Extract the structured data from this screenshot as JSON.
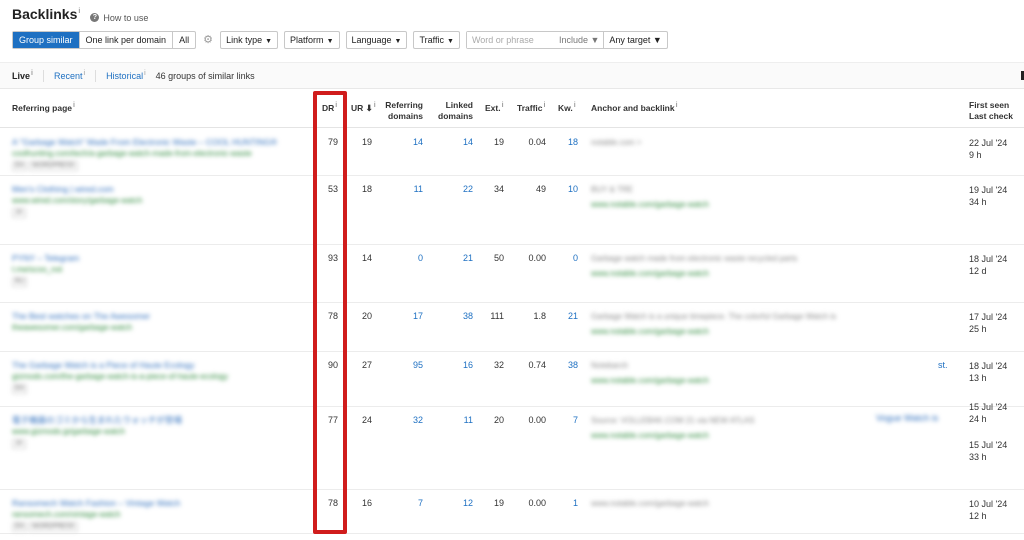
{
  "header": {
    "title": "Backlinks",
    "title_info": "i",
    "howto": "How to use",
    "howto_icon": "question-icon"
  },
  "toolbar": {
    "group_similar": "Group similar",
    "one_link": "One link per domain",
    "all": "All",
    "link_type": "Link type",
    "platform": "Platform",
    "language": "Language",
    "traffic": "Traffic",
    "search_placeholder": "Word or phrase",
    "include": "Include",
    "any_target": "Any target",
    "accent": "#1e70c2"
  },
  "subbar": {
    "live": "Live",
    "recent": "Recent",
    "historical": "Historical",
    "groups_count": "46 groups of similar links"
  },
  "columns": {
    "referring_page": "Referring page",
    "dr": "DR",
    "ur": "UR",
    "referring_domains_1": "Referring",
    "referring_domains_2": "domains",
    "linked_domains_1": "Linked",
    "linked_domains_2": "domains",
    "ext": "Ext.",
    "traffic": "Traffic",
    "kw": "Kw.",
    "anchor": "Anchor and backlink",
    "first_seen": "First seen",
    "last_check": "Last check"
  },
  "rows": [
    {
      "dr": "79",
      "ur": "19",
      "ref_domains": "14",
      "linked": "14",
      "ext": "19",
      "traffic": "0.04",
      "kw": "18",
      "dates": [
        "22 Jul '24",
        "9 h"
      ],
      "page_title": "A \"Garbage Watch\" Made From Electronic Waste – COOL HUNTING®",
      "page_url": "coolhunting.com/tech/a-garbage-watch-made-from-electronic-waste",
      "tags": [
        "EN",
        "WORDPRESS"
      ],
      "anchor_lines": [
        "notable.com  >"
      ]
    },
    {
      "dr": "53",
      "ur": "18",
      "ref_domains": "11",
      "linked": "22",
      "ext": "34",
      "traffic": "49",
      "kw": "10",
      "dates": [
        "19 Jul '24",
        "34 h"
      ],
      "page_title": "Men's Clothing | wired.com",
      "page_url": "www.wired.com/story/garbage-watch",
      "tags": [
        "JA"
      ],
      "anchor_lines": [
        "BUY & TRE",
        "www.notable.com/garbage-watch"
      ]
    },
    {
      "dr": "93",
      "ur": "14",
      "ref_domains": "0",
      "linked": "21",
      "ext": "50",
      "traffic": "0.00",
      "kw": "0",
      "dates": [
        "18 Jul '24",
        "12 d"
      ],
      "page_title": "PYNY – Telegram",
      "page_url": "t.me/scoo_not",
      "tags": [
        "RU"
      ],
      "anchor_lines": [
        "Garbage watch made from electronic waste recycled parts",
        "www.notable.com/garbage-watch"
      ]
    },
    {
      "dr": "78",
      "ur": "20",
      "ref_domains": "17",
      "linked": "38",
      "ext": "111",
      "traffic": "1.8",
      "kw": "21",
      "dates": [
        "17 Jul '24",
        "25 h"
      ],
      "page_title": "The Best watches on The Awesomer",
      "page_url": "theawesomer.com/garbage-watch",
      "tags": [],
      "anchor_lines": [
        "Garbage Watch is a unique timepiece. The colorful Garbage Watch is",
        "www.notable.com/garbage-watch"
      ]
    },
    {
      "dr": "90",
      "ur": "27",
      "ref_domains": "95",
      "linked": "16",
      "ext": "32",
      "traffic": "0.74",
      "kw": "38",
      "dates": [
        "18 Jul '24",
        "13 h"
      ],
      "page_title": "The Garbage Watch is a Piece of Haute Ecology",
      "page_url": "gizmodo.com/the-garbage-watch-is-a-piece-of-haute-ecology",
      "tags": [
        "EN"
      ],
      "anchor_lines": [
        "Notebarch",
        "www.notable.com/garbage-watch"
      ],
      "edge_text": "st."
    },
    {
      "dr": "77",
      "ur": "24",
      "ref_domains": "32",
      "linked": "11",
      "ext": "20",
      "traffic": "0.00",
      "kw": "7",
      "dates": [
        "15 Jul '24",
        "24 h",
        "15 Jul '24",
        "33 h"
      ],
      "page_title": "電子機器のゴミから生まれたウォッチが登場",
      "page_url": "www.gizmodo.jp/garbage-watch",
      "tags": [
        "JA"
      ],
      "anchor_lines": [
        "Source: VOLLEBAK.COM 21 via NEW ATLAS",
        "www.notable.com/garbage-watch"
      ],
      "side_link": "Vogue Watch is"
    },
    {
      "dr": "78",
      "ur": "16",
      "ref_domains": "7",
      "linked": "12",
      "ext": "19",
      "traffic": "0.00",
      "kw": "1",
      "dates": [
        "10 Jul '24",
        "12 h"
      ],
      "page_title": "Ransomech Watch Fashion – Vintage Watch",
      "page_url": "ransomech.com/vintage-watch",
      "tags": [
        "EN",
        "WORDPRESS"
      ],
      "anchor_lines": [
        "www.notable.com/garbage-watch"
      ]
    }
  ]
}
